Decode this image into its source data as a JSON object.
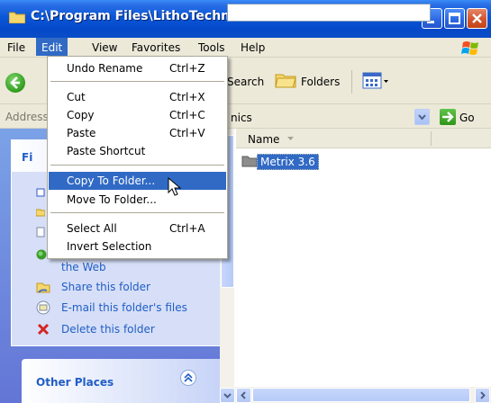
{
  "window": {
    "title": "C:\\Program Files\\LithoTechnics"
  },
  "menubar": {
    "items": [
      "File",
      "Edit",
      "View",
      "Favorites",
      "Tools",
      "Help"
    ],
    "active": "Edit"
  },
  "toolbar": {
    "search_label": "Search",
    "folders_label": "Folders"
  },
  "address": {
    "label": "Address",
    "value": "C:\\Program Files\\LithoTechnics",
    "visible_value": "nics",
    "go_label": "Go"
  },
  "task_pane": {
    "panel_title": "File and Folder Tasks",
    "visible_title": "Fi",
    "links": [
      {
        "label": "the Web",
        "icon": "publish-icon"
      },
      {
        "label": "Share this folder",
        "icon": "share-icon"
      },
      {
        "label": "E-mail this folder's files",
        "icon": "email-icon"
      },
      {
        "label": "Delete this folder",
        "icon": "delete-icon"
      }
    ],
    "other_places": "Other Places"
  },
  "list": {
    "column_name": "Name",
    "files": [
      {
        "name": "Metrix 3.6",
        "selected": true
      }
    ]
  },
  "edit_menu": {
    "items": [
      {
        "label": "Undo Rename",
        "shortcut": "Ctrl+Z"
      },
      {
        "label": "Cut",
        "shortcut": "Ctrl+X"
      },
      {
        "label": "Copy",
        "shortcut": "Ctrl+C"
      },
      {
        "label": "Paste",
        "shortcut": "Ctrl+V"
      },
      {
        "label": "Paste Shortcut",
        "shortcut": ""
      },
      {
        "label": "Copy To Folder...",
        "shortcut": "",
        "highlighted": true
      },
      {
        "label": "Move To Folder...",
        "shortcut": ""
      },
      {
        "label": "Select All",
        "shortcut": "Ctrl+A"
      },
      {
        "label": "Invert Selection",
        "shortcut": ""
      }
    ]
  },
  "colors": {
    "title_bar": "#0a56d8",
    "selection": "#316ac5",
    "task_pane_bg": "#6375d6",
    "link": "#215dc6"
  }
}
